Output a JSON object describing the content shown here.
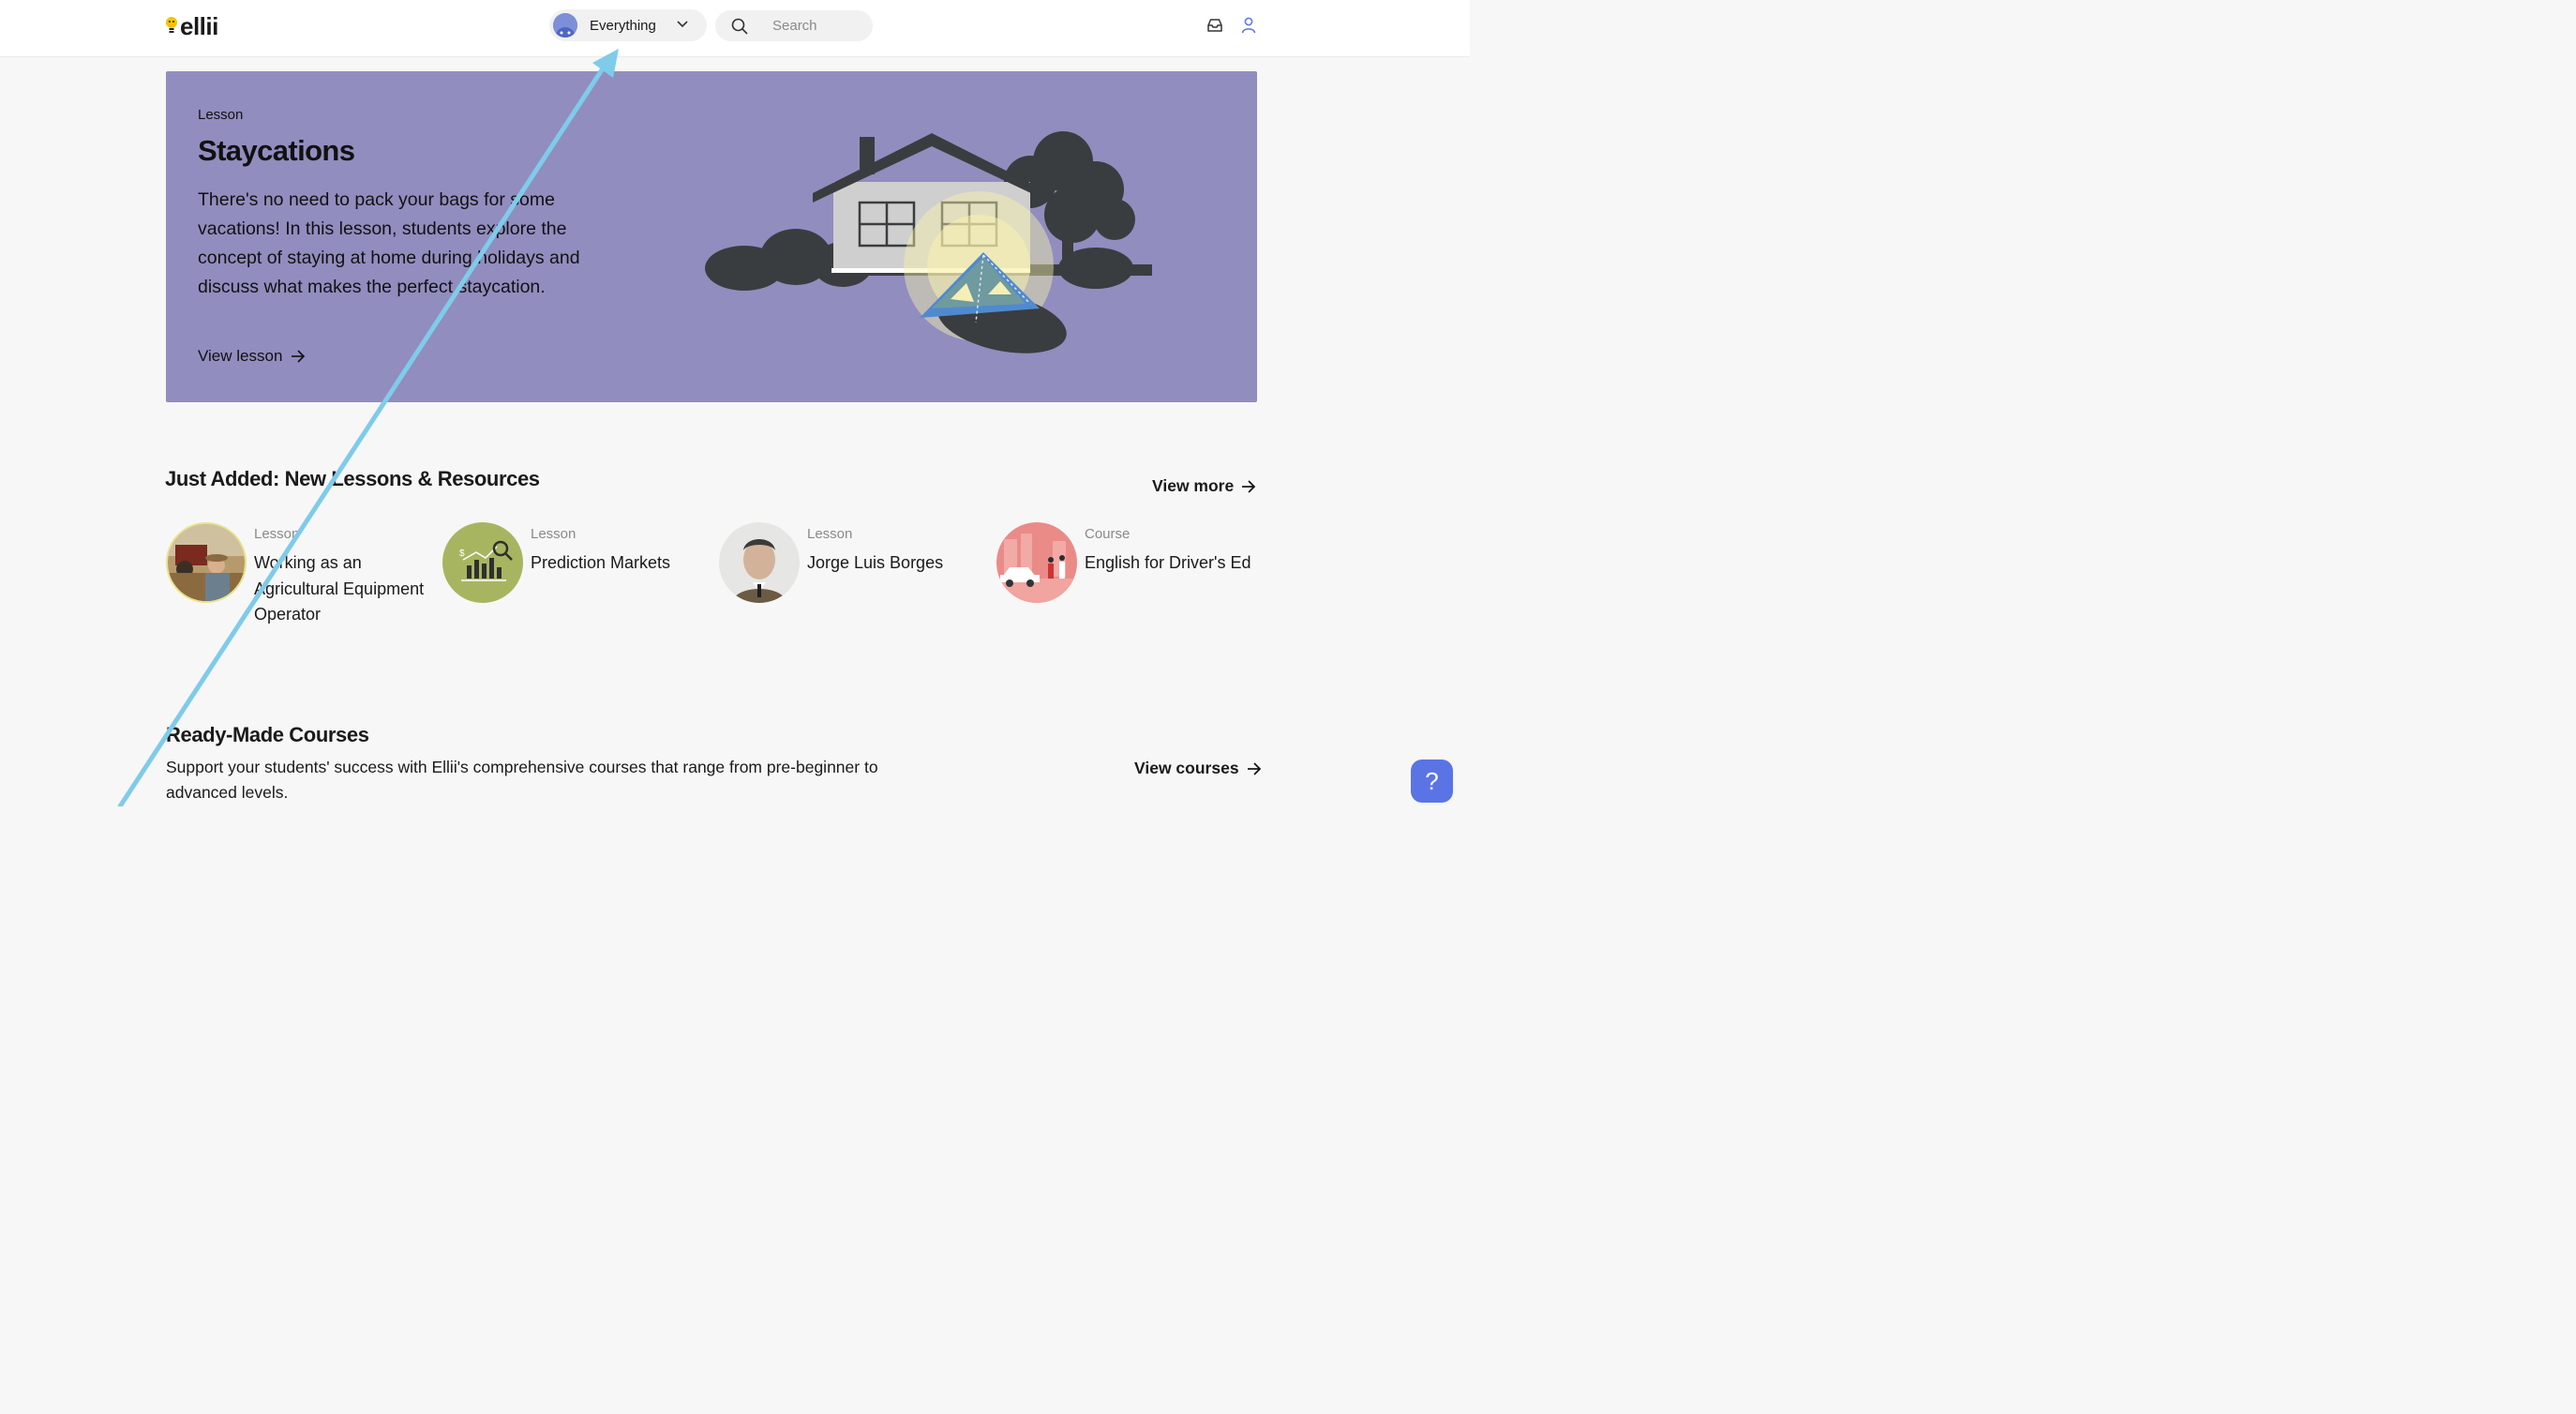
{
  "header": {
    "logo_text": "ellii",
    "scope_label": "Everything",
    "search_placeholder": "Search",
    "icons": [
      "inbox-icon",
      "user-icon"
    ]
  },
  "hero": {
    "kicker": "Lesson",
    "title": "Staycations",
    "description": "There's no need to pack your bags for some vacations! In this lesson, students explore the concept of staying at home during holidays and discuss what makes the perfect staycation.",
    "link_label": "View lesson",
    "background_color": "#918dbf"
  },
  "just_added": {
    "title": "Just Added: New Lessons & Resources",
    "view_more_label": "View more",
    "items": [
      {
        "type": "Lesson",
        "title": "Working as an Agricultural Equipment Operator"
      },
      {
        "type": "Lesson",
        "title": "Prediction Markets"
      },
      {
        "type": "Lesson",
        "title": "Jorge Luis Borges"
      },
      {
        "type": "Course",
        "title": "English for Driver's Ed"
      }
    ]
  },
  "courses": {
    "title": "Ready-Made Courses",
    "description": "Support your students' success with Ellii's comprehensive courses that range from pre-beginner to advanced levels.",
    "view_label": "View courses"
  },
  "help": {
    "label": "?"
  },
  "colors": {
    "accent": "#5a74e6",
    "arrow": "#7fcbea"
  }
}
